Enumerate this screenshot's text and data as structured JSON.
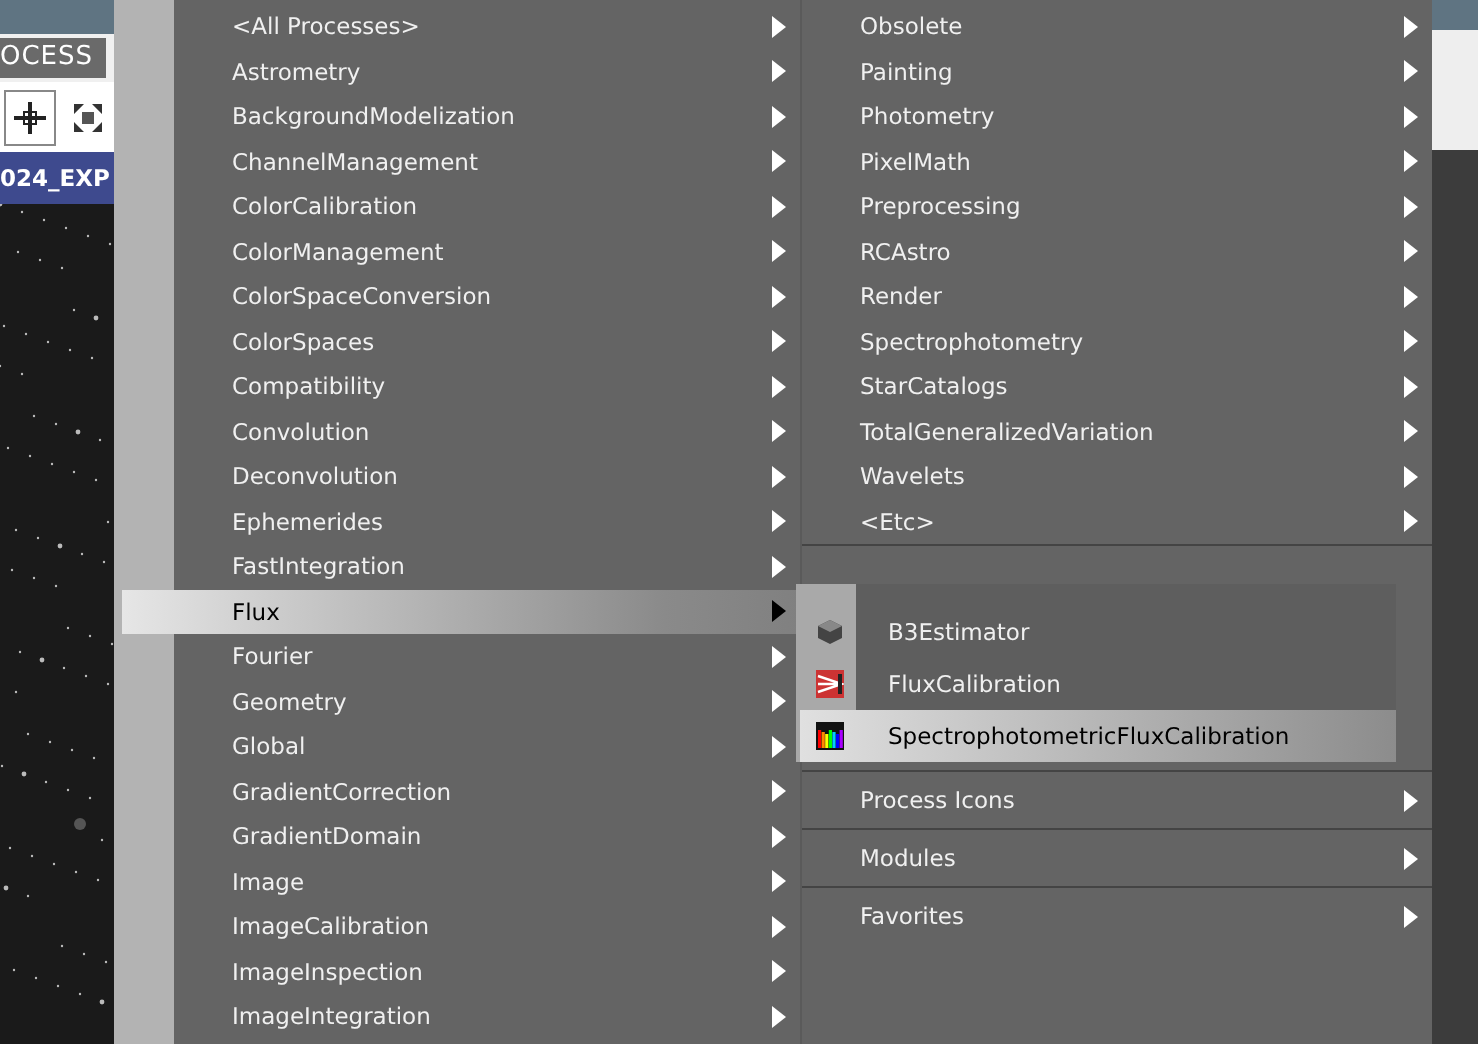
{
  "background": {
    "tab": "OCESS",
    "image_title": "024_EXP"
  },
  "menu": {
    "columns": [
      [
        {
          "label": "<All Processes>",
          "selected": false
        },
        {
          "label": "Astrometry",
          "selected": false
        },
        {
          "label": "BackgroundModelization",
          "selected": false
        },
        {
          "label": "ChannelManagement",
          "selected": false
        },
        {
          "label": "ColorCalibration",
          "selected": false
        },
        {
          "label": "ColorManagement",
          "selected": false
        },
        {
          "label": "ColorSpaceConversion",
          "selected": false
        },
        {
          "label": "ColorSpaces",
          "selected": false
        },
        {
          "label": "Compatibility",
          "selected": false
        },
        {
          "label": "Convolution",
          "selected": false
        },
        {
          "label": "Deconvolution",
          "selected": false
        },
        {
          "label": "Ephemerides",
          "selected": false
        },
        {
          "label": "FastIntegration",
          "selected": false
        },
        {
          "label": "Flux",
          "selected": true
        },
        {
          "label": "Fourier",
          "selected": false
        },
        {
          "label": "Geometry",
          "selected": false
        },
        {
          "label": "Global",
          "selected": false
        },
        {
          "label": "GradientCorrection",
          "selected": false
        },
        {
          "label": "GradientDomain",
          "selected": false
        },
        {
          "label": "Image",
          "selected": false
        },
        {
          "label": "ImageCalibration",
          "selected": false
        },
        {
          "label": "ImageInspection",
          "selected": false
        },
        {
          "label": "ImageIntegration",
          "selected": false
        }
      ],
      [
        {
          "label": "Obsolete",
          "selected": false
        },
        {
          "label": "Painting",
          "selected": false
        },
        {
          "label": "Photometry",
          "selected": false
        },
        {
          "label": "PixelMath",
          "selected": false
        },
        {
          "label": "Preprocessing",
          "selected": false
        },
        {
          "label": "RCAstro",
          "selected": false
        },
        {
          "label": "Render",
          "selected": false
        },
        {
          "label": "Spectrophotometry",
          "selected": false
        },
        {
          "label": "StarCatalogs",
          "selected": false
        },
        {
          "label": "TotalGeneralizedVariation",
          "selected": false
        },
        {
          "label": "Wavelets",
          "selected": false
        },
        {
          "label": "<Etc>",
          "selected": false
        }
      ]
    ],
    "bottom_items": [
      "Process Icons",
      "Modules",
      "Favorites"
    ]
  },
  "submenu": {
    "items": [
      {
        "label": "B3Estimator",
        "kind": "cube",
        "selected": false
      },
      {
        "label": "FluxCalibration",
        "kind": "flux",
        "selected": false
      },
      {
        "label": "SpectrophotometricFluxCalibration",
        "kind": "spectrum",
        "selected": true
      }
    ]
  }
}
